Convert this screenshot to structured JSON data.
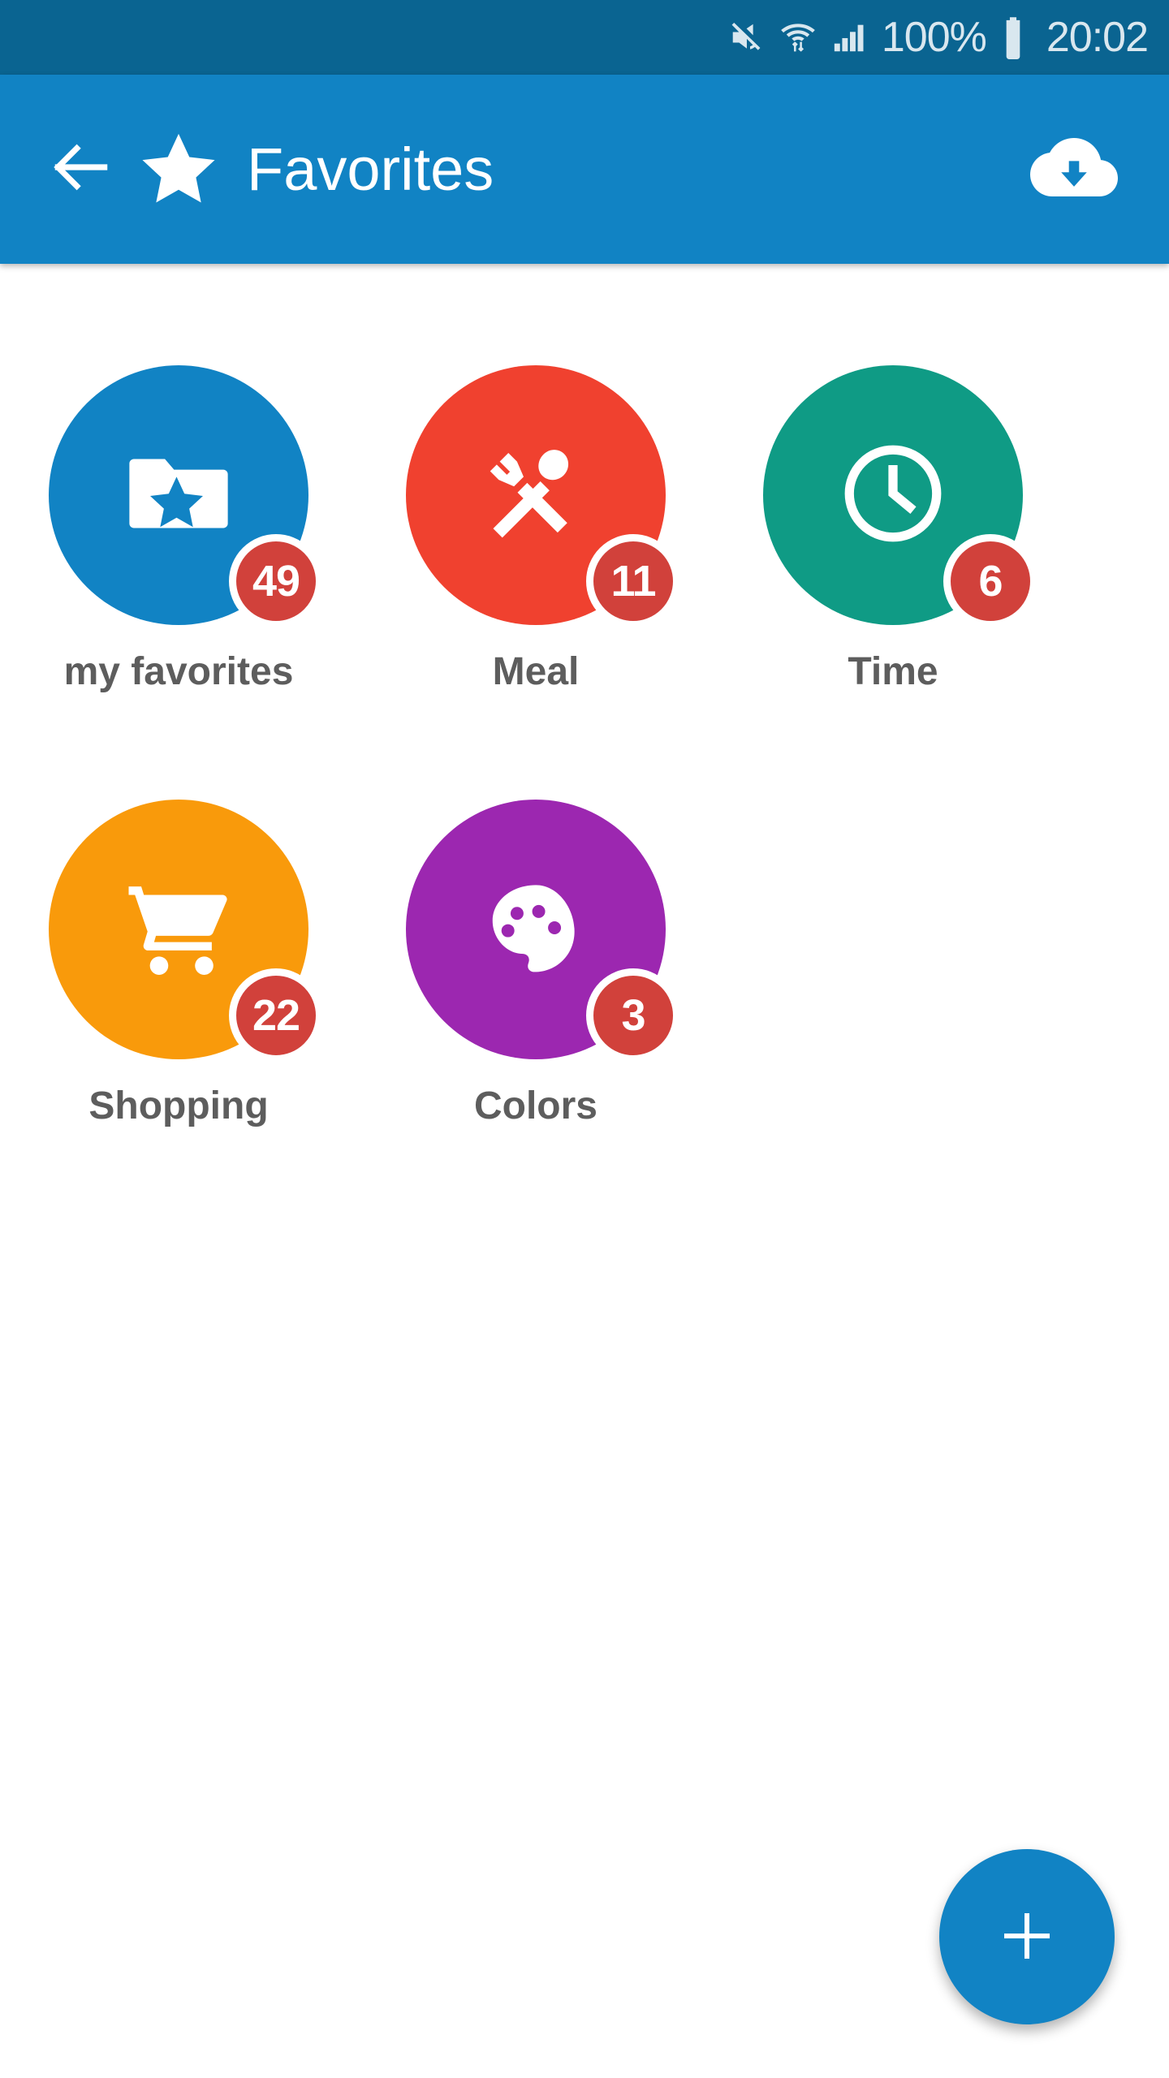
{
  "status_bar": {
    "background": "#0a6491",
    "foreground": "#d9e7ef",
    "mute_icon": "mute-icon",
    "wifi_icon": "wifi-transfer-icon",
    "signal_icon": "cellular-signal-icon",
    "battery_percent": "100%",
    "battery_icon": "battery-full-icon",
    "clock": "20:02"
  },
  "app_bar": {
    "background": "#1183c4",
    "back_icon": "arrow-left-icon",
    "star_icon": "star-icon",
    "title": "Favorites",
    "action_icon": "cloud-download-icon"
  },
  "grid": {
    "items": [
      {
        "label": "my favorites",
        "icon": "folder-star-icon",
        "color": "#1183c4",
        "badge": "49"
      },
      {
        "label": "Meal",
        "icon": "cutlery-icon",
        "color": "#f0412f",
        "badge": "11"
      },
      {
        "label": "Time",
        "icon": "clock-icon",
        "color": "#0f9b85",
        "badge": "6"
      },
      {
        "label": "Shopping",
        "icon": "shopping-cart-icon",
        "color": "#f99a0b",
        "badge": "22"
      },
      {
        "label": "Colors",
        "icon": "palette-icon",
        "color": "#9c27b0",
        "badge": "3"
      }
    ],
    "badge_color": "#d1413b",
    "label_color": "#5d5d5d"
  },
  "fab": {
    "icon": "plus-icon",
    "label": "+",
    "color": "#1183c4"
  }
}
